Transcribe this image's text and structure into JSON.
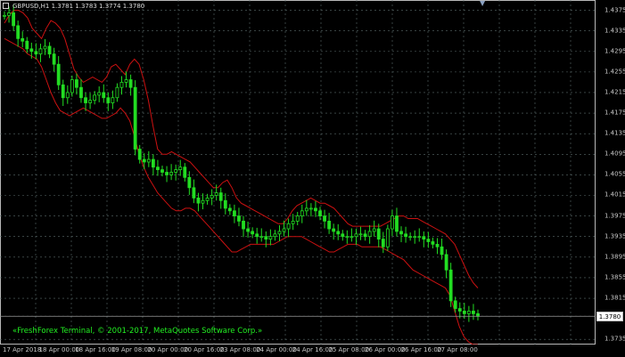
{
  "symbol_info": "GBPUSD,H1  1.3781 1.3783 1.3774 1.3780",
  "copyright": "«FreshForex Terminal, © 2001-2017, MetaQuotes Software Corp.»",
  "current_price": "1.3780",
  "icons": [
    "chart-shift-arrow-icon",
    "symbol-menu-icon"
  ],
  "colors": {
    "background": "#000000",
    "grid": "#5a6a6a",
    "candles": "#22dd22",
    "bands": "#cc1111",
    "copyright": "#22ee22",
    "axis_text": "#c8c8c8"
  },
  "chart_data": {
    "type": "line",
    "title": "GBPUSD,H1",
    "ylim": [
      1.3725,
      1.4395
    ],
    "y_ticks": [
      "1.4375",
      "1.4335",
      "1.4295",
      "1.4255",
      "1.4215",
      "1.4175",
      "1.4135",
      "1.4095",
      "1.4055",
      "1.4015",
      "1.3975",
      "1.3935",
      "1.3895",
      "1.3855",
      "1.3815",
      "1.3780",
      "1.3735"
    ],
    "x_ticks": [
      "17 Apr 2018",
      "18 Apr 00:00",
      "18 Apr 16:00",
      "19 Apr 08:00",
      "20 Apr 00:00",
      "20 Apr 16:00",
      "23 Apr 08:00",
      "24 Apr 00:00",
      "24 Apr 16:00",
      "25 Apr 08:00",
      "26 Apr 00:00",
      "26 Apr 16:00",
      "27 Apr 08:00"
    ],
    "grid": true,
    "series": [
      {
        "values": [
          1.4365,
          1.437,
          1.4345,
          1.432,
          1.4315,
          1.43,
          1.4295,
          1.429,
          1.43,
          1.4305,
          1.429,
          1.427,
          1.423,
          1.4205,
          1.4215,
          1.424,
          1.4225,
          1.4205,
          1.4195,
          1.42,
          1.421,
          1.4215,
          1.4205,
          1.4195,
          1.4205,
          1.4225,
          1.4235,
          1.424,
          1.4225,
          1.4105,
          1.4085,
          1.408,
          1.4085,
          1.407,
          1.4065,
          1.406,
          1.4055,
          1.406,
          1.4065,
          1.407,
          1.405,
          1.403,
          1.401,
          1.4,
          1.4005,
          1.401,
          1.4015,
          1.402,
          1.4005,
          1.399,
          1.3985,
          1.3975,
          1.3965,
          1.395,
          1.3945,
          1.394,
          1.3935,
          1.3935,
          1.393,
          1.3935,
          1.394,
          1.3945,
          1.395,
          1.396,
          1.3965,
          1.3975,
          1.3985,
          1.399,
          1.399,
          1.3985,
          1.3975,
          1.3965,
          1.395,
          1.3945,
          1.394,
          1.3935,
          1.3935,
          1.3935,
          1.394,
          1.394,
          1.3935,
          1.3945,
          1.395,
          1.393,
          1.3915,
          1.395,
          1.3975,
          1.3945,
          1.394,
          1.3935,
          1.3935,
          1.3935,
          1.3935,
          1.393,
          1.3925,
          1.392,
          1.3915,
          1.39,
          1.387,
          1.381,
          1.3795,
          1.379,
          1.3785,
          1.379,
          1.3785,
          1.378
        ]
      }
    ],
    "bands": {
      "upper": [
        1.435,
        1.4365,
        1.4375,
        1.4375,
        1.437,
        1.436,
        1.434,
        1.433,
        1.432,
        1.434,
        1.4355,
        1.435,
        1.434,
        1.432,
        1.429,
        1.426,
        1.4245,
        1.4235,
        1.424,
        1.4245,
        1.424,
        1.4235,
        1.4245,
        1.4265,
        1.427,
        1.426,
        1.425,
        1.427,
        1.428,
        1.427,
        1.424,
        1.42,
        1.415,
        1.4105,
        1.4095,
        1.4095,
        1.41,
        1.4095,
        1.409,
        1.4085,
        1.408,
        1.407,
        1.406,
        1.405,
        1.404,
        1.403,
        1.403,
        1.404,
        1.4045,
        1.403,
        1.401,
        1.4,
        1.3995,
        1.399,
        1.3985,
        1.398,
        1.3975,
        1.397,
        1.3965,
        1.396,
        1.396,
        1.397,
        1.3985,
        1.3995,
        1.4,
        1.4005,
        1.401,
        1.4005,
        1.4,
        1.4,
        1.3995,
        1.399,
        1.398,
        1.397,
        1.396,
        1.3955,
        1.3955,
        1.3955,
        1.3955,
        1.3955,
        1.3955,
        1.3955,
        1.396,
        1.3965,
        1.397,
        1.3975,
        1.3975,
        1.397,
        1.397,
        1.397,
        1.3965,
        1.396,
        1.3955,
        1.395,
        1.3945,
        1.394,
        1.393,
        1.392,
        1.39,
        1.388,
        1.386,
        1.3845,
        1.3835
      ],
      "lower": [
        1.432,
        1.4315,
        1.431,
        1.4305,
        1.43,
        1.429,
        1.4285,
        1.428,
        1.4265,
        1.424,
        1.4215,
        1.4195,
        1.418,
        1.4175,
        1.417,
        1.4175,
        1.418,
        1.4185,
        1.418,
        1.4175,
        1.417,
        1.4165,
        1.4165,
        1.417,
        1.4175,
        1.4185,
        1.4175,
        1.416,
        1.413,
        1.4095,
        1.407,
        1.405,
        1.4035,
        1.402,
        1.401,
        1.4,
        1.399,
        1.3985,
        1.3985,
        1.399,
        1.399,
        1.3985,
        1.3975,
        1.3965,
        1.3955,
        1.3945,
        1.3935,
        1.3925,
        1.3915,
        1.3905,
        1.3905,
        1.391,
        1.3915,
        1.392,
        1.392,
        1.392,
        1.392,
        1.392,
        1.392,
        1.3925,
        1.393,
        1.3935,
        1.3935,
        1.3935,
        1.3935,
        1.393,
        1.3925,
        1.392,
        1.3915,
        1.391,
        1.3905,
        1.3905,
        1.391,
        1.3915,
        1.392,
        1.392,
        1.392,
        1.3915,
        1.3915,
        1.3915,
        1.3915,
        1.3915,
        1.391,
        1.3905,
        1.39,
        1.3895,
        1.389,
        1.388,
        1.387,
        1.3865,
        1.386,
        1.3855,
        1.385,
        1.3845,
        1.384,
        1.3835,
        1.382,
        1.379,
        1.376,
        1.374,
        1.373,
        1.3725,
        1.3725
      ]
    }
  }
}
